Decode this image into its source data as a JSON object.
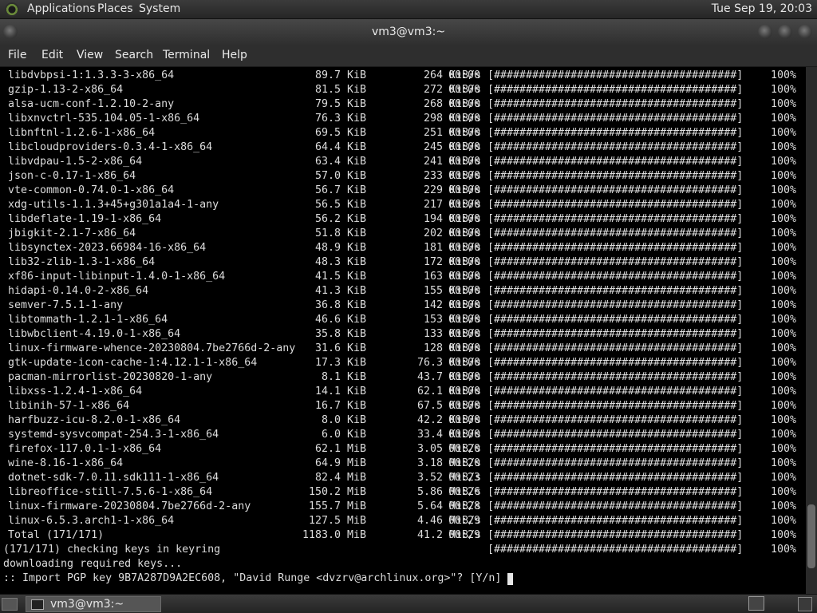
{
  "top_panel": {
    "applications": "Applications",
    "places": "Places",
    "system": "System",
    "clock": "Tue Sep 19, 20:03"
  },
  "window": {
    "title": "vm3@vm3:~"
  },
  "menubar": {
    "file": "File",
    "edit": "Edit",
    "view": "View",
    "search": "Search",
    "terminal": "Terminal",
    "help": "Help"
  },
  "terminal": {
    "rows": [
      {
        "name": "libdvbpsi-1:1.3.3-3-x86_64",
        "size": "89.7 KiB",
        "speed": "264 KiB/s",
        "time": "00:00",
        "bar": "[######################################]",
        "pct": "100%"
      },
      {
        "name": "gzip-1.13-2-x86_64",
        "size": "81.5 KiB",
        "speed": "272 KiB/s",
        "time": "00:00",
        "bar": "[######################################]",
        "pct": "100%"
      },
      {
        "name": "alsa-ucm-conf-1.2.10-2-any",
        "size": "79.5 KiB",
        "speed": "268 KiB/s",
        "time": "00:00",
        "bar": "[######################################]",
        "pct": "100%"
      },
      {
        "name": "libxnvctrl-535.104.05-1-x86_64",
        "size": "76.3 KiB",
        "speed": "298 KiB/s",
        "time": "00:00",
        "bar": "[######################################]",
        "pct": "100%"
      },
      {
        "name": "libnftnl-1.2.6-1-x86_64",
        "size": "69.5 KiB",
        "speed": "251 KiB/s",
        "time": "00:00",
        "bar": "[######################################]",
        "pct": "100%"
      },
      {
        "name": "libcloudproviders-0.3.4-1-x86_64",
        "size": "64.4 KiB",
        "speed": "245 KiB/s",
        "time": "00:00",
        "bar": "[######################################]",
        "pct": "100%"
      },
      {
        "name": "libvdpau-1.5-2-x86_64",
        "size": "63.4 KiB",
        "speed": "241 KiB/s",
        "time": "00:00",
        "bar": "[######################################]",
        "pct": "100%"
      },
      {
        "name": "json-c-0.17-1-x86_64",
        "size": "57.0 KiB",
        "speed": "233 KiB/s",
        "time": "00:00",
        "bar": "[######################################]",
        "pct": "100%"
      },
      {
        "name": "vte-common-0.74.0-1-x86_64",
        "size": "56.7 KiB",
        "speed": "229 KiB/s",
        "time": "00:00",
        "bar": "[######################################]",
        "pct": "100%"
      },
      {
        "name": "xdg-utils-1.1.3+45+g301a1a4-1-any",
        "size": "56.5 KiB",
        "speed": "217 KiB/s",
        "time": "00:00",
        "bar": "[######################################]",
        "pct": "100%"
      },
      {
        "name": "libdeflate-1.19-1-x86_64",
        "size": "56.2 KiB",
        "speed": "194 KiB/s",
        "time": "00:00",
        "bar": "[######################################]",
        "pct": "100%"
      },
      {
        "name": "jbigkit-2.1-7-x86_64",
        "size": "51.8 KiB",
        "speed": "202 KiB/s",
        "time": "00:00",
        "bar": "[######################################]",
        "pct": "100%"
      },
      {
        "name": "libsynctex-2023.66984-16-x86_64",
        "size": "48.9 KiB",
        "speed": "181 KiB/s",
        "time": "00:00",
        "bar": "[######################################]",
        "pct": "100%"
      },
      {
        "name": "lib32-zlib-1.3-1-x86_64",
        "size": "48.3 KiB",
        "speed": "172 KiB/s",
        "time": "00:00",
        "bar": "[######################################]",
        "pct": "100%"
      },
      {
        "name": "xf86-input-libinput-1.4.0-1-x86_64",
        "size": "41.5 KiB",
        "speed": "163 KiB/s",
        "time": "00:00",
        "bar": "[######################################]",
        "pct": "100%"
      },
      {
        "name": "hidapi-0.14.0-2-x86_64",
        "size": "41.3 KiB",
        "speed": "155 KiB/s",
        "time": "00:00",
        "bar": "[######################################]",
        "pct": "100%"
      },
      {
        "name": "semver-7.5.1-1-any",
        "size": "36.8 KiB",
        "speed": "142 KiB/s",
        "time": "00:00",
        "bar": "[######################################]",
        "pct": "100%"
      },
      {
        "name": "libtommath-1.2.1-1-x86_64",
        "size": "46.6 KiB",
        "speed": "153 KiB/s",
        "time": "00:00",
        "bar": "[######################################]",
        "pct": "100%"
      },
      {
        "name": "libwbclient-4.19.0-1-x86_64",
        "size": "35.8 KiB",
        "speed": "133 KiB/s",
        "time": "00:00",
        "bar": "[######################################]",
        "pct": "100%"
      },
      {
        "name": "linux-firmware-whence-20230804.7be2766d-2-any",
        "size": "31.6 KiB",
        "speed": "128 KiB/s",
        "time": "00:00",
        "bar": "[######################################]",
        "pct": "100%"
      },
      {
        "name": "gtk-update-icon-cache-1:4.12.1-1-x86_64",
        "size": "17.3 KiB",
        "speed": "76.3 KiB/s",
        "time": "00:00",
        "bar": "[######################################]",
        "pct": "100%"
      },
      {
        "name": "pacman-mirrorlist-20230820-1-any",
        "size": "8.1 KiB",
        "speed": "43.7 KiB/s",
        "time": "00:00",
        "bar": "[######################################]",
        "pct": "100%"
      },
      {
        "name": "libxss-1.2.4-1-x86_64",
        "size": "14.1 KiB",
        "speed": "62.1 KiB/s",
        "time": "00:00",
        "bar": "[######################################]",
        "pct": "100%"
      },
      {
        "name": "libinih-57-1-x86_64",
        "size": "16.7 KiB",
        "speed": "67.5 KiB/s",
        "time": "00:00",
        "bar": "[######################################]",
        "pct": "100%"
      },
      {
        "name": "harfbuzz-icu-8.2.0-1-x86_64",
        "size": "8.0 KiB",
        "speed": "42.2 KiB/s",
        "time": "00:00",
        "bar": "[######################################]",
        "pct": "100%"
      },
      {
        "name": "systemd-sysvcompat-254.3-1-x86_64",
        "size": "6.0 KiB",
        "speed": "33.4 KiB/s",
        "time": "00:00",
        "bar": "[######################################]",
        "pct": "100%"
      },
      {
        "name": "firefox-117.0.1-1-x86_64",
        "size": "62.1 MiB",
        "speed": "3.05 MiB/s",
        "time": "00:20",
        "bar": "[######################################]",
        "pct": "100%"
      },
      {
        "name": "wine-8.16-1-x86_64",
        "size": "64.9 MiB",
        "speed": "3.18 MiB/s",
        "time": "00:20",
        "bar": "[######################################]",
        "pct": "100%"
      },
      {
        "name": "dotnet-sdk-7.0.11.sdk111-1-x86_64",
        "size": "82.4 MiB",
        "speed": "3.52 MiB/s",
        "time": "00:23",
        "bar": "[######################################]",
        "pct": "100%"
      },
      {
        "name": "libreoffice-still-7.5.6-1-x86_64",
        "size": "150.2 MiB",
        "speed": "5.86 MiB/s",
        "time": "00:26",
        "bar": "[######################################]",
        "pct": "100%"
      },
      {
        "name": "linux-firmware-20230804.7be2766d-2-any",
        "size": "155.7 MiB",
        "speed": "5.64 MiB/s",
        "time": "00:28",
        "bar": "[######################################]",
        "pct": "100%"
      },
      {
        "name": "linux-6.5.3.arch1-1-x86_64",
        "size": "127.5 MiB",
        "speed": "4.46 MiB/s",
        "time": "00:29",
        "bar": "[######################################]",
        "pct": "100%"
      },
      {
        "name": "Total (171/171)",
        "size": "1183.0 MiB",
        "speed": "41.2 MiB/s",
        "time": "00:29",
        "bar": "[######################################]",
        "pct": "100%"
      }
    ],
    "checking_line": {
      "text": "(171/171) checking keys in keyring",
      "bar": "[######################################]",
      "pct": "100%"
    },
    "downloading_line": "downloading required keys...",
    "prompt_line": ":: Import PGP key 9B7A287D9A2EC608, \"David Runge <dvzrv@archlinux.org>\"? [Y/n]"
  },
  "bottom_panel": {
    "task_label": "vm3@vm3:~"
  },
  "colors": {
    "panel": "#2c2c2c",
    "terminal_bg": "#000000",
    "terminal_fg": "#dcdcdc"
  }
}
